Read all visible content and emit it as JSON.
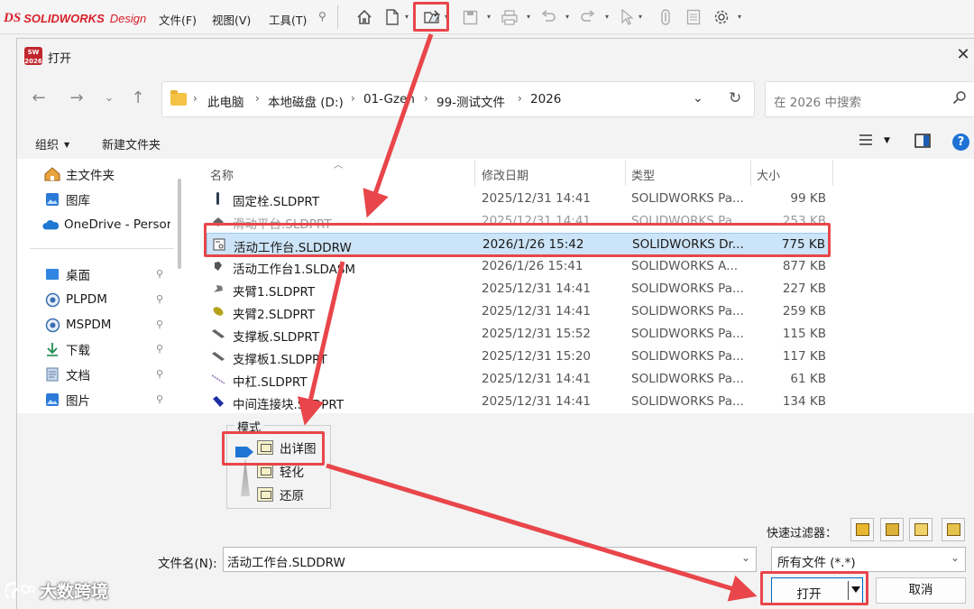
{
  "app": {
    "logo_ds": "DS",
    "logo_brand": "SOLIDWORKS",
    "logo_design": "Design",
    "menus": [
      "文件(F)",
      "视图(V)",
      "工具(T)"
    ],
    "pin": "📌"
  },
  "dialog": {
    "title": "打开",
    "close": "✕",
    "app_icon_text": "SW 2026",
    "breadcrumbs": [
      "此电脑",
      "本地磁盘 (D:)",
      "01-Gzen",
      "99-测试文件",
      "2026"
    ],
    "search_placeholder": "在 2026 中搜索",
    "organize": "组织",
    "new_folder": "新建文件夹",
    "help": "?"
  },
  "nav": {
    "items": [
      {
        "label": "主文件夹",
        "icon": "home-icon",
        "pinned": false
      },
      {
        "label": "图库",
        "icon": "gallery-icon",
        "pinned": false
      },
      {
        "label": "OneDrive - Persor",
        "icon": "onedrive-icon",
        "pinned": false
      },
      {
        "label": "桌面",
        "icon": "desktop-icon",
        "pinned": true
      },
      {
        "label": "PLPDM",
        "icon": "pdm-icon",
        "pinned": true
      },
      {
        "label": "MSPDM",
        "icon": "pdm-icon",
        "pinned": true
      },
      {
        "label": "下载",
        "icon": "download-icon",
        "pinned": true
      },
      {
        "label": "文档",
        "icon": "documents-icon",
        "pinned": true
      },
      {
        "label": "图片",
        "icon": "pictures-icon",
        "pinned": true
      }
    ]
  },
  "files": {
    "columns": [
      "名称",
      "修改日期",
      "类型",
      "大小"
    ],
    "rows": [
      {
        "name": "固定栓.SLDPRT",
        "date": "2025/12/31 14:41",
        "type": "SOLIDWORKS Pa...",
        "size": "99 KB",
        "icon": "part-icon"
      },
      {
        "name": "滑动平台.SLDPRT",
        "date": "2025/12/31 14:41",
        "type": "SOLIDWORKS Pa...",
        "size": "253 KB",
        "icon": "part-icon"
      },
      {
        "name": "活动工作台.SLDDRW",
        "date": "2026/1/26 15:42",
        "type": "SOLIDWORKS Dr...",
        "size": "775 KB",
        "icon": "drawing-icon"
      },
      {
        "name": "活动工作台1.SLDASM",
        "date": "2026/1/26 15:41",
        "type": "SOLIDWORKS A...",
        "size": "877 KB",
        "icon": "assembly-icon"
      },
      {
        "name": "夹臂1.SLDPRT",
        "date": "2025/12/31 14:41",
        "type": "SOLIDWORKS Pa...",
        "size": "227 KB",
        "icon": "part-icon"
      },
      {
        "name": "夹臂2.SLDPRT",
        "date": "2025/12/31 14:41",
        "type": "SOLIDWORKS Pa...",
        "size": "259 KB",
        "icon": "part-icon"
      },
      {
        "name": "支撑板.SLDPRT",
        "date": "2025/12/31 15:52",
        "type": "SOLIDWORKS Pa...",
        "size": "115 KB",
        "icon": "part-icon"
      },
      {
        "name": "支撑板1.SLDPRT",
        "date": "2025/12/31 15:20",
        "type": "SOLIDWORKS Pa...",
        "size": "117 KB",
        "icon": "part-icon"
      },
      {
        "name": "中杠.SLDPRT",
        "date": "2025/12/31 14:41",
        "type": "SOLIDWORKS Pa...",
        "size": "61 KB",
        "icon": "part-icon"
      },
      {
        "name": "中间连接块.SLDPRT",
        "date": "2025/12/31 14:41",
        "type": "SOLIDWORKS Pa...",
        "size": "134 KB",
        "icon": "part-icon"
      }
    ],
    "selected_index": 2
  },
  "mode": {
    "label": "模式",
    "items": [
      "出详图",
      "轻化",
      "还原"
    ],
    "selected": "出详图"
  },
  "footer": {
    "quick_filter_label": "快速过滤器：",
    "filename_label": "文件名(N):",
    "filename_value": "活动工作台.SLDDRW",
    "filetype_value": "所有文件 (*.*)",
    "open_button": "打开",
    "cancel_button": "取消"
  },
  "watermark": "大数跨境",
  "colors": {
    "accent": "#0067c0",
    "selection": "#cce4f7",
    "annotation": "#e8464a",
    "brand": "#d8202a"
  }
}
